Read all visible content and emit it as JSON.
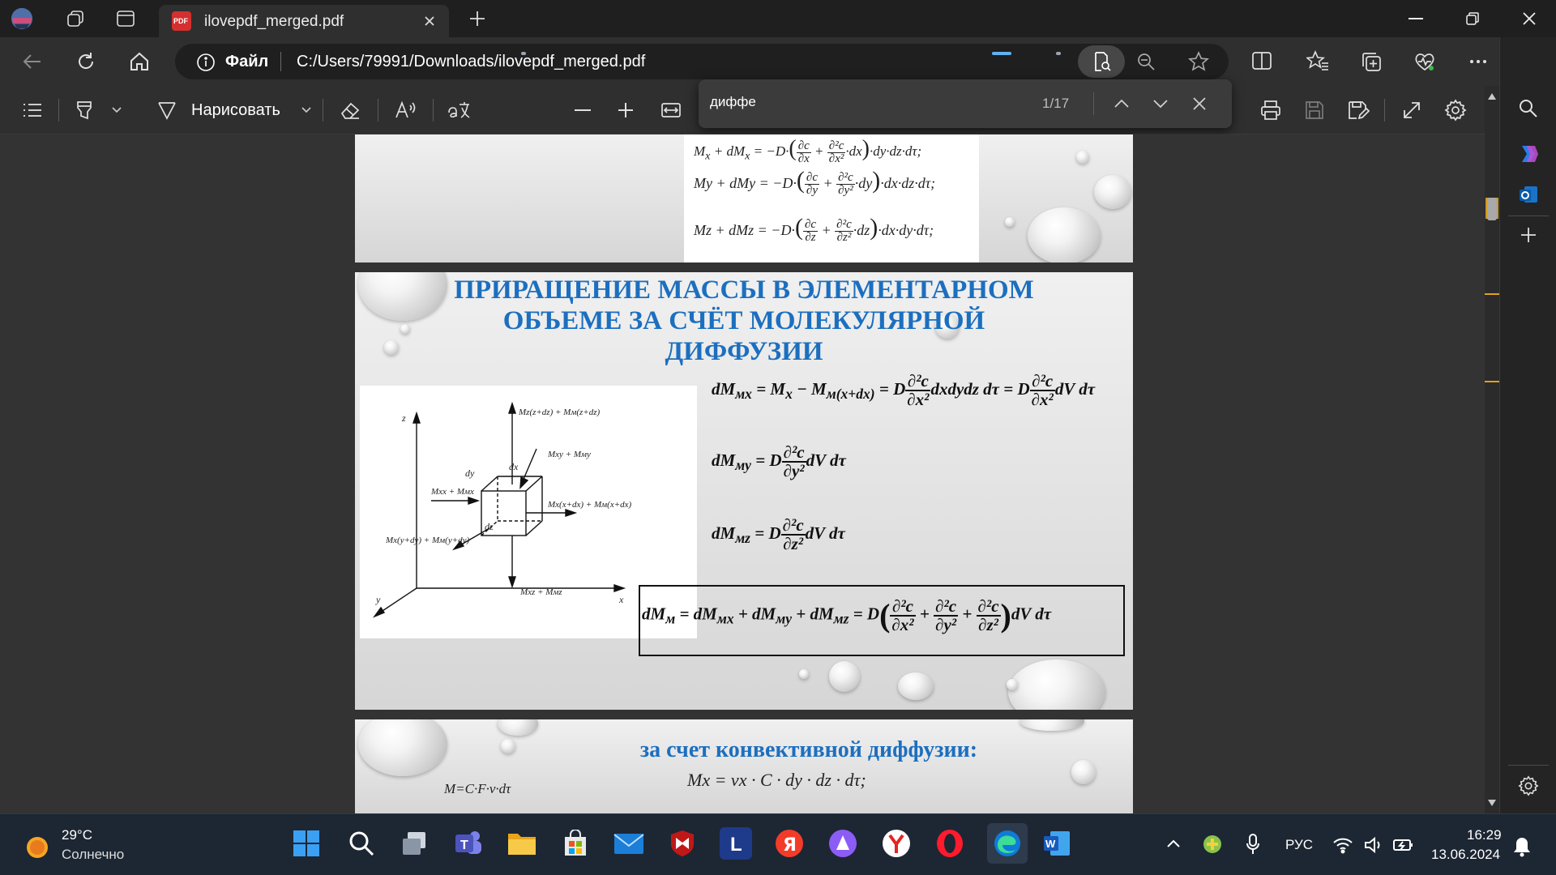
{
  "browser": {
    "tab_title": "ilovepdf_merged.pdf",
    "tab_icon_label": "PDF",
    "address_label": "Файл",
    "address_url": "C:/Users/79991/Downloads/ilovepdf_merged.pdf"
  },
  "pdf_toolbar": {
    "draw_label": "Нарисовать",
    "read_aloud_icon": "read-aloud-icon",
    "translate_icon": "translate-icon"
  },
  "find": {
    "query": "диффе",
    "count": "1/17"
  },
  "document": {
    "slide1": {
      "eq1": "Mx + dMx = −D·(∂c/∂x + ∂²c/∂x²·dx)·dy·dz·dτ;",
      "eq2": "My + dMy = −D·",
      "eq2_tail": "·dx·dz·dτ;",
      "eq3": "Mz + dMz = −D·",
      "eq3_tail": "·dx·dy·dτ;"
    },
    "slide2": {
      "title_line1": "ПРИРАЩЕНИЕ МАССЫ В ЭЛЕМЕНТАРНОМ",
      "title_line2": "ОБЪЕМЕ ЗА СЧЁТ МОЛЕКУЛЯРНОЙ",
      "title_line3": "ДИФФУЗИИ",
      "eq_x_left": "dM",
      "eq_x_mid": "= M",
      "eq_x_rest": "− M",
      "eq_x_tail": "dxdydz dτ = D",
      "eq_x_end": "dV dτ",
      "eq_y_left": "dM",
      "eq_y_tail": "dV dτ",
      "eq_z_left": "dM",
      "eq_z_tail": "dV dτ",
      "eq_sum_left": "dM",
      "eq_sum_mid": "= dM",
      "eq_sum_tail": "dV dτ",
      "diagram_labels": {
        "z": "z",
        "y": "y",
        "x": "x",
        "dx": "dx",
        "dy": "dy",
        "dz": "dz",
        "top": "Mz(z+dz) + Mм(z+dz)",
        "right_top": "Mxy + Mмy",
        "right": "Mx(x+dx) + Mм(x+dx)",
        "left": "Mxx + Mмx",
        "left_bottom": "Mx(y+dy) + Mм(y+dy)",
        "bottom": "Mxz + Mмz"
      }
    },
    "slide3": {
      "title": "за счет конвективной диффузии:",
      "left_eq": "M=C·F·v·dτ",
      "eq1": "Mx = vx · C · dy · dz · dτ;"
    }
  },
  "taskbar": {
    "weather_temp": "29°C",
    "weather_desc": "Солнечно",
    "language": "РУС",
    "time": "16:29",
    "date": "13.06.2024"
  },
  "colors": {
    "accent_title": "#1c6fbf",
    "taskbar_bg": "#1d2633",
    "edge_accent": "#0f7bd8"
  }
}
